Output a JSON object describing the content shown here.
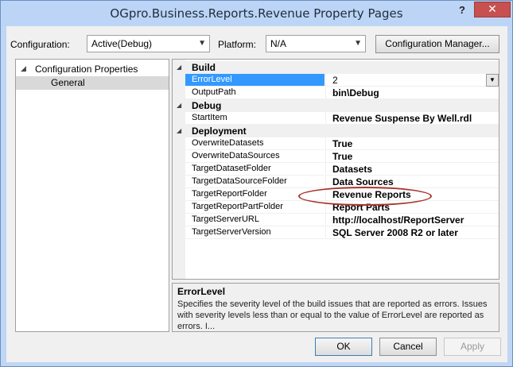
{
  "window": {
    "title": "OGpro.Business.Reports.Revenue Property Pages",
    "help_glyph": "?",
    "close_glyph": "✕"
  },
  "config_bar": {
    "configuration_label": "Configuration:",
    "configuration_value": "Active(Debug)",
    "platform_label": "Platform:",
    "platform_value": "N/A",
    "config_manager_button": "Configuration Manager..."
  },
  "tree": {
    "root": "Configuration Properties",
    "items": [
      "General"
    ]
  },
  "properties": {
    "categories": [
      {
        "name": "Build",
        "rows": [
          {
            "name": "ErrorLevel",
            "value": "2"
          },
          {
            "name": "OutputPath",
            "value": "bin\\Debug"
          }
        ]
      },
      {
        "name": "Debug",
        "rows": [
          {
            "name": "StartItem",
            "value": "Revenue Suspense By Well.rdl"
          }
        ]
      },
      {
        "name": "Deployment",
        "rows": [
          {
            "name": "OverwriteDatasets",
            "value": "True"
          },
          {
            "name": "OverwriteDataSources",
            "value": "True"
          },
          {
            "name": "TargetDatasetFolder",
            "value": "Datasets"
          },
          {
            "name": "TargetDataSourceFolder",
            "value": "Data Sources"
          },
          {
            "name": "TargetReportFolder",
            "value": "Revenue Reports"
          },
          {
            "name": "TargetReportPartFolder",
            "value": "Report Parts"
          },
          {
            "name": "TargetServerURL",
            "value": "http://localhost/ReportServer"
          },
          {
            "name": "TargetServerVersion",
            "value": "SQL Server 2008 R2 or later"
          }
        ]
      }
    ]
  },
  "description": {
    "title": "ErrorLevel",
    "text": "Specifies the severity level of the build issues that are reported as errors. Issues with severity levels less than or equal to the value of ErrorLevel are reported as errors. I..."
  },
  "buttons": {
    "ok": "OK",
    "cancel": "Cancel",
    "apply": "Apply"
  },
  "colors": {
    "title_bar": "#bcd5f6",
    "selection": "#3399ff",
    "highlight_ellipse": "#a8342e",
    "close_button": "#c75050"
  }
}
